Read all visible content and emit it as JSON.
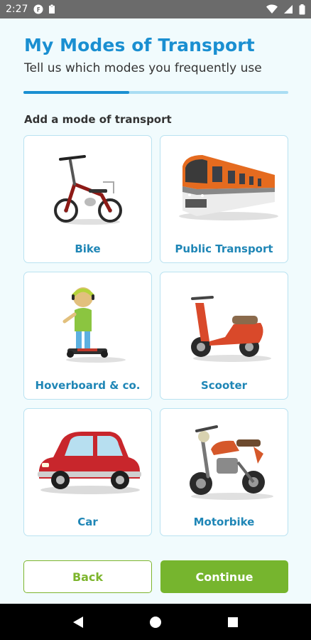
{
  "status_bar": {
    "time": "2:27",
    "icons_left": [
      "circle-f-icon",
      "clipboard-icon"
    ],
    "icons_right": [
      "wifi-icon",
      "cellular-icon",
      "battery-icon"
    ]
  },
  "header": {
    "title": "My Modes of Transport",
    "subtitle": "Tell us which modes you frequently use",
    "progress_fraction": 0.4
  },
  "section": {
    "label": "Add a mode of transport"
  },
  "modes": [
    {
      "label": "Bike",
      "icon": "bike-icon"
    },
    {
      "label": "Public Transport",
      "icon": "train-icon"
    },
    {
      "label": "Hoverboard & co.",
      "icon": "hoverboard-icon"
    },
    {
      "label": "Scooter",
      "icon": "scooter-icon"
    },
    {
      "label": "Car",
      "icon": "car-icon"
    },
    {
      "label": "Motorbike",
      "icon": "motorbike-icon"
    }
  ],
  "buttons": {
    "back": "Back",
    "continue": "Continue"
  },
  "colors": {
    "title": "#1a8fd1",
    "progress": "#1a8fd1",
    "progress_track": "#a9ddf3",
    "card_border": "#b9e2f1",
    "card_label": "#1f86b6",
    "accent_green": "#76b52e",
    "background": "#f1fbfd"
  }
}
